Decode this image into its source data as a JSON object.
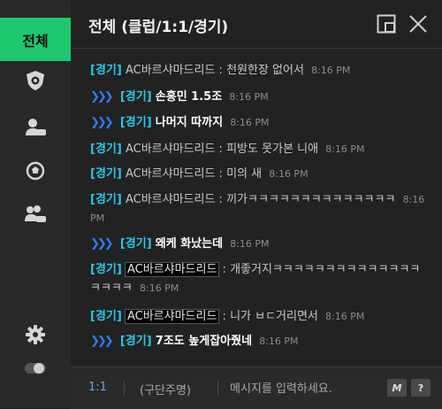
{
  "sidebar": {
    "active_tab": "전체",
    "icons": [
      "shield-icon",
      "user-chat-icon",
      "soccer-ball-icon",
      "group-chat-icon"
    ],
    "bottom_icons": [
      "gear-icon",
      "toggle-icon"
    ],
    "accent": "#1ec86e"
  },
  "header": {
    "title": "전체 (클럽/1:1/경기)"
  },
  "messages": [
    {
      "tag": "[경기]",
      "sender": "AC바르샤마드리드",
      "sep": " : ",
      "text": "천원한장 없어서",
      "time": "8:16 PM"
    },
    {
      "tag": "[경기]",
      "text": "손흥민 1.5조",
      "time": "8:16 PM"
    },
    {
      "tag": "[경기]",
      "text": "나머지 따까지",
      "time": "8:16 PM"
    },
    {
      "tag": "[경기]",
      "sender": "AC바르샤마드리드",
      "sep": " : ",
      "text": "피방도 못가본 니애",
      "time": "8:16 PM"
    },
    {
      "tag": "[경기]",
      "sender": "AC바르샤마드리드",
      "sep": " : ",
      "text": "미의 새",
      "time": "8:16 PM"
    },
    {
      "tag": "[경기]",
      "sender": "AC바르샤마드리드",
      "sep": " : ",
      "text": "끼가ㅋㅋㅋㅋㅋㅋㅋㅋㅋㅋㅋㅋㅋㅋ",
      "time": "8:16 PM"
    },
    {
      "tag": "[경기]",
      "text": "왜케 화났는데",
      "time": "8:16 PM"
    },
    {
      "tag": "[경기]",
      "sender": "AC바르샤마드리드",
      "sep": " : ",
      "text": "개좋거지ㅋㅋㅋㅋㅋㅋㅋㅋㅋㅋㅋㅋㅋㅋㅋㅋㅋㅋ",
      "time": "8:16 PM"
    },
    {
      "tag": "[경기]",
      "sender": "AC바르샤마드리드",
      "sep": " : ",
      "text": "니가 ㅂㄷ거리면서",
      "time": "8:16 PM"
    },
    {
      "tag": "[경기]",
      "text": "7조도 높게잡아줬네",
      "time": "8:16 PM"
    }
  ],
  "footer": {
    "mode": "1:1",
    "mode_option": "(구단주명)",
    "input_placeholder": "메시지를 입력하세요.",
    "macro_label": "M",
    "help_label": "?"
  },
  "colors": {
    "tag": "#28c8e8",
    "arrow": "#2f7cf0",
    "time": "#8c8c8c"
  }
}
